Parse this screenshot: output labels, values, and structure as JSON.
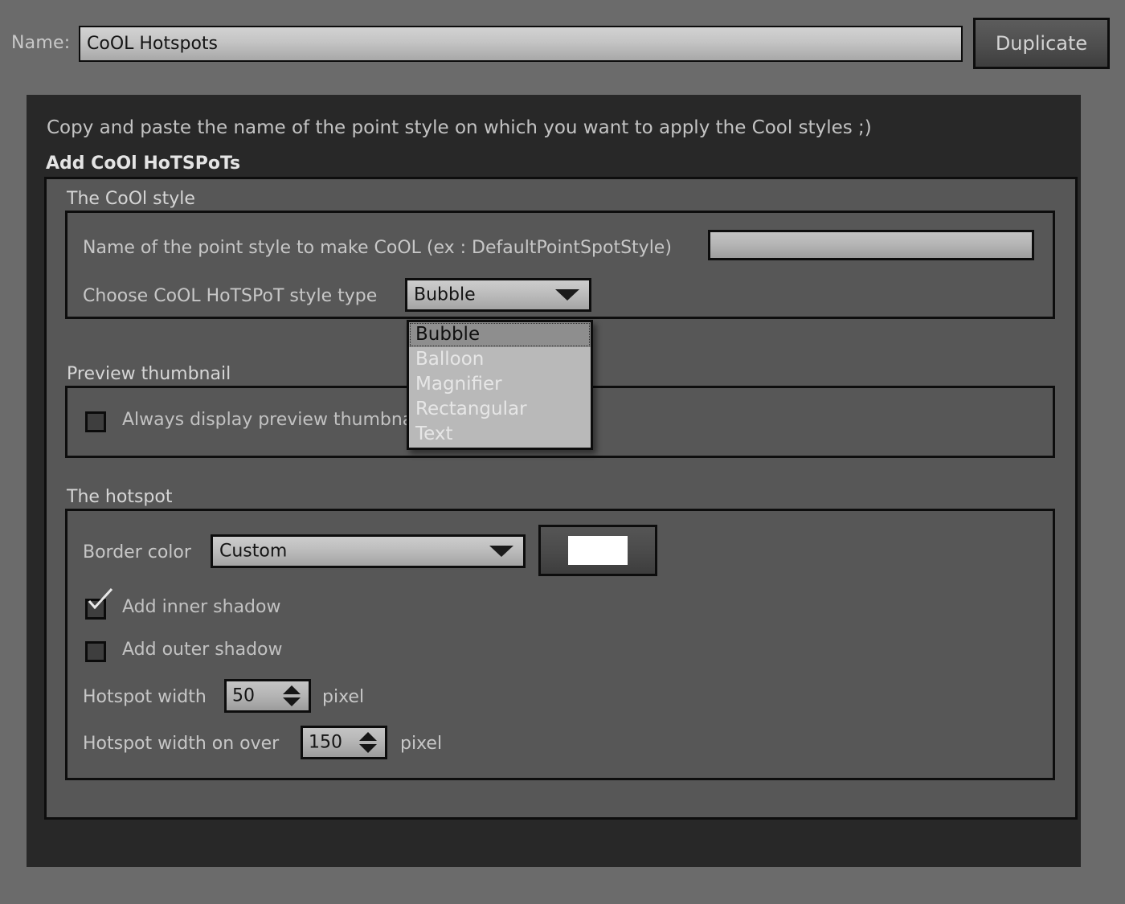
{
  "header": {
    "name_label": "Name:",
    "name_value": "CoOL Hotspots",
    "duplicate_label": "Duplicate"
  },
  "panel": {
    "hint": "Copy and paste the name of the point style on which you want to apply the Cool styles ;)",
    "group_legend": "Add CoOl HoTSPoTs"
  },
  "cool_style": {
    "legend": "The CoOl style",
    "point_style_label": "Name of the point style to make CoOL (ex : DefaultPointSpotStyle)",
    "point_style_value": "",
    "style_type_label": "Choose CoOL HoTSPoT style type",
    "style_type_value": "Bubble",
    "style_type_options": [
      "Bubble",
      "Balloon",
      "Magnifier",
      "Rectangular",
      "Text"
    ],
    "dropdown_open": true
  },
  "preview": {
    "legend": "Preview thumbnail",
    "checkbox_label": "Always display preview thumbnail",
    "checkbox_checked": false
  },
  "hotspot": {
    "legend": "The hotspot",
    "border_color_label": "Border color",
    "border_color_value": "Custom",
    "swatch_color": "#ffffff",
    "inner_shadow_label": "Add inner shadow",
    "inner_shadow_checked": true,
    "outer_shadow_label": "Add outer shadow",
    "outer_shadow_checked": false,
    "width_label": "Hotspot width",
    "width_value": "50",
    "width_unit": "pixel",
    "width_over_label": "Hotspot width on over",
    "width_over_value": "150",
    "width_over_unit": "pixel"
  },
  "colors": {
    "background": "#6b6b6b",
    "panel": "#282828",
    "group": "#575757",
    "border": "#0d0d0d",
    "text": "#c7c7c7"
  }
}
